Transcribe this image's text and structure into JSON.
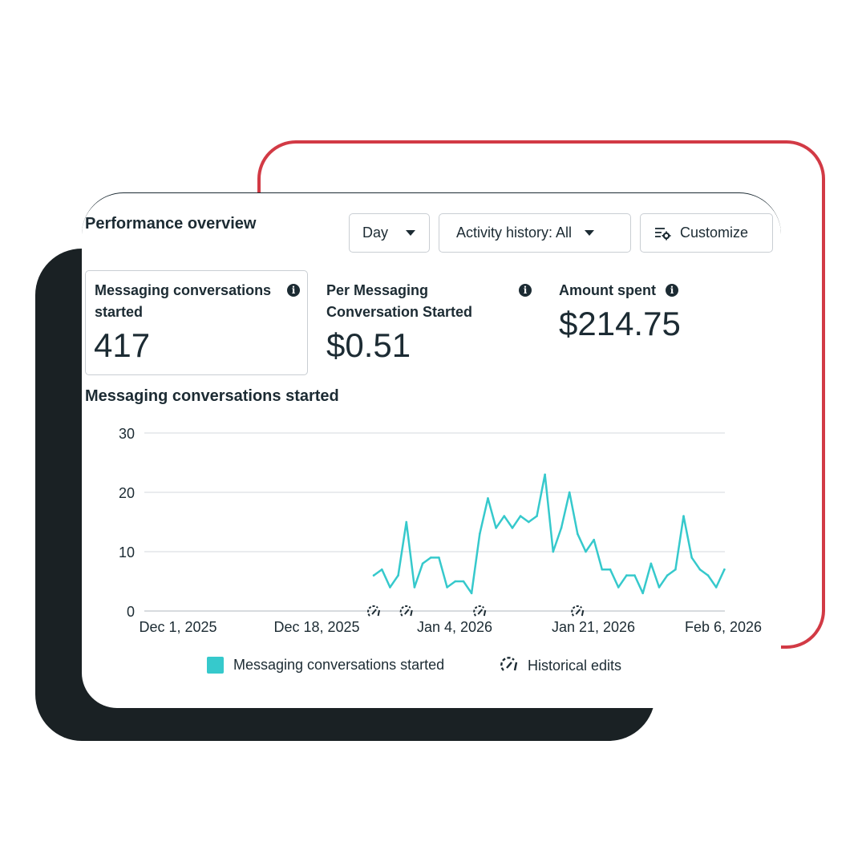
{
  "header": {
    "title": "Performance overview",
    "period_select": "Day",
    "activity_select": "Activity history: All",
    "customize_label": "Customize"
  },
  "metrics": [
    {
      "label_line1": "Messaging conversations",
      "label_line2": "started",
      "value": "417"
    },
    {
      "label_line1": "Per Messaging",
      "label_line2": "Conversation Started",
      "value": "$0.51"
    },
    {
      "label_line1": "Amount spent",
      "value": "$214.75"
    }
  ],
  "section_title": "Messaging conversations started",
  "colors": {
    "series": "#36c9cc",
    "accent_frame": "#d23a45",
    "text": "#1c2b33"
  },
  "chart_data": {
    "type": "line",
    "title": "Messaging conversations started",
    "x_axis": {
      "type": "date",
      "tick_labels": [
        "Dec 1, 2025",
        "Dec 18, 2025",
        "Jan 4, 2026",
        "Jan 21, 2026",
        "Feb 6, 2026"
      ]
    },
    "y_axis": {
      "ticks": [
        0,
        10,
        20,
        30
      ],
      "ylim": [
        0,
        30
      ]
    },
    "grid": true,
    "legend_position": "bottom",
    "series": [
      {
        "name": "Messaging conversations started",
        "x": [
          "2025-12-25",
          "2025-12-26",
          "2025-12-27",
          "2025-12-28",
          "2025-12-29",
          "2025-12-30",
          "2025-12-31",
          "2026-01-01",
          "2026-01-02",
          "2026-01-03",
          "2026-01-04",
          "2026-01-05",
          "2026-01-06",
          "2026-01-07",
          "2026-01-08",
          "2026-01-09",
          "2026-01-10",
          "2026-01-11",
          "2026-01-12",
          "2026-01-13",
          "2026-01-14",
          "2026-01-15",
          "2026-01-16",
          "2026-01-17",
          "2026-01-18",
          "2026-01-19",
          "2026-01-20",
          "2026-01-21",
          "2026-01-22",
          "2026-01-23",
          "2026-01-24",
          "2026-01-25",
          "2026-01-26",
          "2026-01-27",
          "2026-01-28",
          "2026-01-29",
          "2026-01-30",
          "2026-01-31",
          "2026-02-01",
          "2026-02-02",
          "2026-02-03",
          "2026-02-04",
          "2026-02-05",
          "2026-02-06"
        ],
        "y": [
          6,
          7,
          4,
          6,
          15,
          4,
          8,
          9,
          9,
          4,
          5,
          5,
          3,
          13,
          19,
          14,
          16,
          14,
          16,
          15,
          16,
          23,
          10,
          14,
          20,
          13,
          10,
          12,
          7,
          7,
          4,
          6,
          6,
          3,
          8,
          4,
          6,
          7,
          16,
          9,
          7,
          6,
          4,
          7
        ]
      }
    ],
    "annotations": {
      "name": "Historical edits",
      "dates": [
        "2025-12-25",
        "2025-12-29",
        "2026-01-07",
        "2026-01-19"
      ]
    }
  },
  "legend": {
    "series_label": "Messaging conversations started",
    "edits_label": "Historical edits"
  }
}
